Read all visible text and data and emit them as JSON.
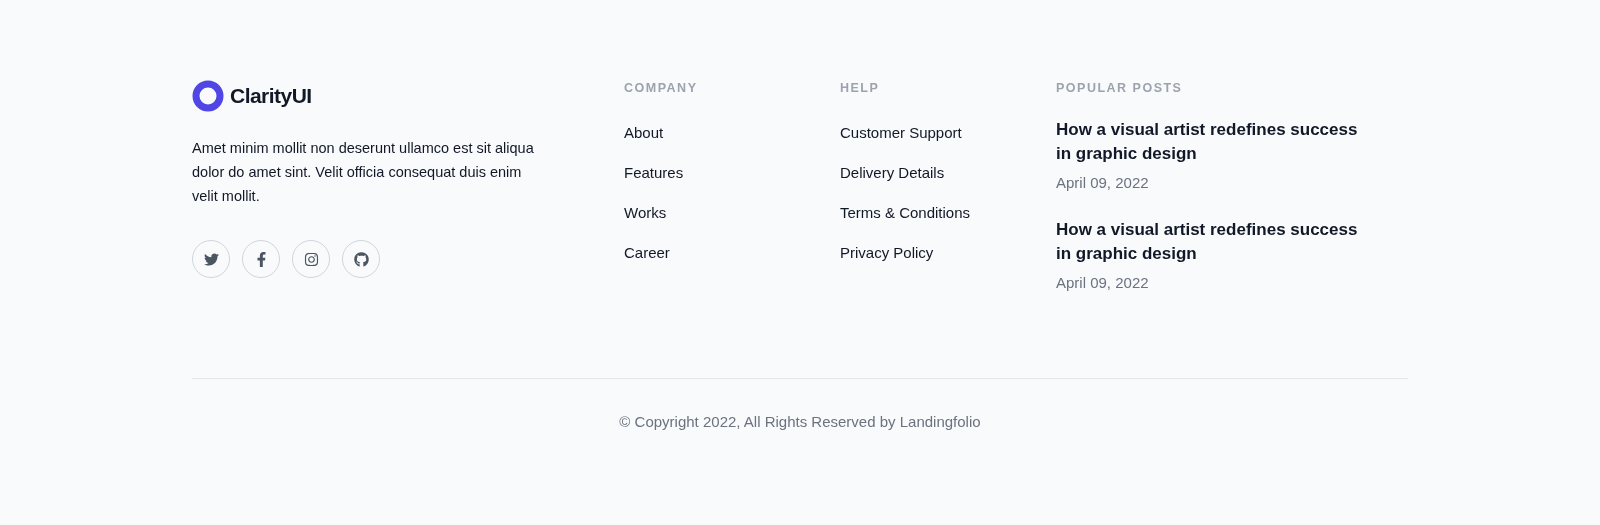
{
  "brand": {
    "name": "ClarityUI",
    "description": "Amet minim mollit non deserunt ullamco est sit aliqua dolor do amet sint. Velit officia consequat duis enim velit mollit."
  },
  "socials": [
    {
      "kind": "twitter"
    },
    {
      "kind": "facebook"
    },
    {
      "kind": "instagram"
    },
    {
      "kind": "github"
    }
  ],
  "link_columns": [
    {
      "heading": "COMPANY",
      "links": [
        "About",
        "Features",
        "Works",
        "Career"
      ]
    },
    {
      "heading": "HELP",
      "links": [
        "Customer Support",
        "Delivery Details",
        "Terms & Conditions",
        "Privacy Policy"
      ]
    }
  ],
  "popular_posts": {
    "heading": "POPULAR POSTS",
    "posts": [
      {
        "title": "How a visual artist redefines success in graphic design",
        "date": "April 09, 2022"
      },
      {
        "title": "How a visual artist redefines success in graphic design",
        "date": "April 09, 2022"
      }
    ]
  },
  "copyright": "© Copyright 2022, All Rights Reserved by Landingfolio"
}
